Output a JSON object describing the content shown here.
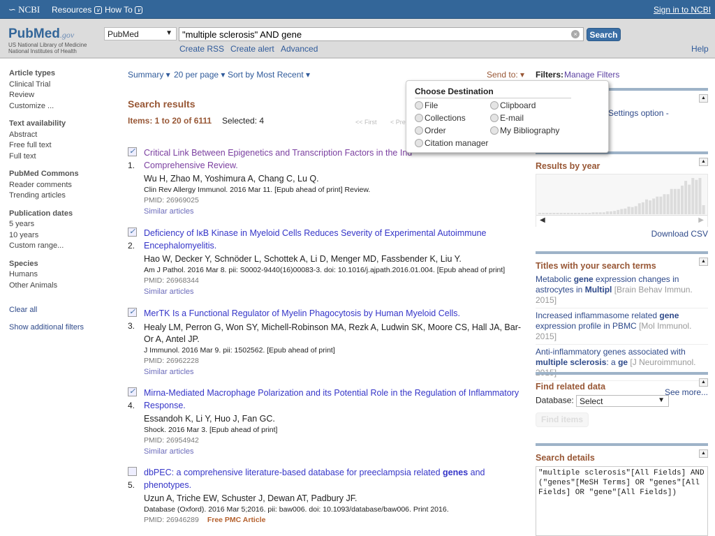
{
  "topbar": {
    "ncbi": "NCBI",
    "resources": "Resources",
    "howto": "How To",
    "signin": "Sign in to NCBI"
  },
  "header": {
    "logo": "PubMed",
    "logo_suffix": ".gov",
    "org1": "US National Library of Medicine",
    "org2": "National Institutes of Health",
    "database": "PubMed",
    "query": "\"multiple sclerosis\" AND gene",
    "search": "Search",
    "links": [
      "Create RSS",
      "Create alert",
      "Advanced"
    ],
    "help": "Help"
  },
  "sidebar": {
    "groups": [
      {
        "title": "Article types",
        "items": [
          "Clinical Trial",
          "Review",
          "Customize ..."
        ]
      },
      {
        "title": "Text availability",
        "items": [
          "Abstract",
          "Free full text",
          "Full text"
        ]
      },
      {
        "title": "PubMed Commons",
        "items": [
          "Reader comments",
          "Trending articles"
        ]
      },
      {
        "title": "Publication dates",
        "items": [
          "5 years",
          "10 years",
          "Custom range..."
        ]
      },
      {
        "title": "Species",
        "items": [
          "Humans",
          "Other Animals"
        ]
      }
    ],
    "clear_all": "Clear all",
    "show_filters": "Show additional filters"
  },
  "toolbar": {
    "summary": "Summary",
    "per_page": "20 per page",
    "sort": "Sort by Most Recent",
    "send_to": "Send to:",
    "filters": "Filters:",
    "manage": "Manage Filters"
  },
  "results": {
    "heading": "Search results",
    "items_label": "Items: 1 to 20 of 6111",
    "selected": "Selected: 4",
    "first": "<< First",
    "prev": "< Prev",
    "list": [
      {
        "n": "1.",
        "checked": true,
        "visited": true,
        "title": [
          [
            "Critical Link Between Epigenetics and Transcription Factors in the Ind",
            0
          ]
        ],
        "title2": [
          [
            "Comprehensive Review.",
            0
          ]
        ],
        "authors": "Wu H, Zhao M, Yoshimura A, Chang C, Lu Q.",
        "source": "Clin Rev Allergy Immunol. 2016 Mar 11. [Epub ahead of print] Review.",
        "pmid": "PMID: 26969025",
        "similar": "Similar articles"
      },
      {
        "n": "2.",
        "checked": true,
        "visited": false,
        "title": [
          [
            "Deficiency of IκB Kinase in Myeloid Cells Reduces Severity of Experimental Autoimmune",
            0
          ]
        ],
        "title2": [
          [
            "Encephalomyelitis.",
            0
          ]
        ],
        "authors": "Hao W, Decker Y, Schnöder L, Schottek A, Li D, Menger MD, Fassbender K, Liu Y.",
        "source": "Am J Pathol. 2016 Mar 8. pii: S0002-9440(16)00083-3. doi: 10.1016/j.ajpath.2016.01.004. [Epub ahead of print]",
        "pmid": "PMID: 26968344",
        "similar": "Similar articles"
      },
      {
        "n": "3.",
        "checked": true,
        "visited": false,
        "title": [
          [
            "MerTK Is a Functional Regulator of Myelin Phagocytosis by Human Myeloid Cells.",
            0
          ]
        ],
        "title2": [],
        "authors": "Healy LM, Perron G, Won SY, Michell-Robinson MA, Rezk A, Ludwin SK, Moore CS, Hall JA, Bar-Or A, Antel JP.",
        "source": "J Immunol. 2016 Mar 9. pii: 1502562. [Epub ahead of print]",
        "pmid": "PMID: 26962228",
        "similar": "Similar articles"
      },
      {
        "n": "4.",
        "checked": true,
        "visited": false,
        "title": [
          [
            "Mirna-Mediated Macrophage Polarization and its Potential Role in the Regulation of Inflammatory",
            0
          ]
        ],
        "title2": [
          [
            "Response.",
            0
          ]
        ],
        "authors": "Essandoh K, Li Y, Huo J, Fan GC.",
        "source": "Shock. 2016 Mar 3. [Epub ahead of print]",
        "pmid": "PMID: 26954942",
        "similar": "Similar articles"
      },
      {
        "n": "5.",
        "checked": false,
        "visited": false,
        "title": [
          [
            "dbPEC: a comprehensive literature-based database for preeclampsia related ",
            0
          ],
          [
            "genes",
            1
          ],
          [
            " and",
            0
          ]
        ],
        "title2": [
          [
            "phenotypes.",
            0
          ]
        ],
        "authors": "Uzun A, Triche EW, Schuster J, Dewan AT, Padbury JF.",
        "source": "Database (Oxford). 2016 Mar 5;2016. pii: baw006. doi: 10.1093/database/baw006. Print 2016.",
        "pmid": "PMID: 26946289",
        "free": "Free PMC Article"
      }
    ]
  },
  "send_menu": {
    "title": "Choose Destination",
    "options": [
      "File",
      "Collections",
      "Order",
      "Citation manager",
      "Clipboard",
      "E-mail",
      "My Bibliography"
    ]
  },
  "right": {
    "settings_text": "Settings option -",
    "results_by_year": {
      "title": "Results by year",
      "download": "Download CSV",
      "bars": [
        3,
        3,
        3,
        3,
        3,
        3,
        3,
        3,
        3,
        3,
        3,
        3,
        3,
        3,
        3,
        4,
        4,
        4,
        4,
        6,
        6,
        7,
        9,
        11,
        12,
        16,
        15,
        17,
        23,
        25,
        31,
        29,
        33,
        37,
        37,
        42,
        42,
        53,
        53,
        53,
        60,
        70,
        62,
        76,
        72,
        76,
        19
      ],
      "bar_color": "#dcdcdc"
    },
    "titles": {
      "title": "Titles with your search terms",
      "items": [
        {
          "text": [
            [
              "Metabolic ",
              0
            ],
            [
              "gene",
              1
            ],
            [
              " expression changes in astrocytes in ",
              0
            ],
            [
              "Multipl",
              1
            ]
          ],
          "journal": "[Brain Behav Immun. 2015]"
        },
        {
          "text": [
            [
              "Increased inflammasome related ",
              0
            ],
            [
              "gene",
              1
            ],
            [
              " expression profile in PBMC ",
              0
            ]
          ],
          "journal": "[Mol Immunol. 2015]"
        },
        {
          "text": [
            [
              "Anti-inflammatory genes associated with ",
              0
            ],
            [
              "multiple sclerosis",
              1
            ],
            [
              ": a ",
              0
            ],
            [
              "ge",
              1
            ]
          ],
          "journal": "[J Neuroimmunol. 2015]"
        }
      ],
      "see_more": "See more..."
    },
    "related": {
      "title": "Find related data",
      "db_label": "Database:",
      "db_value": "Select",
      "find": "Find items"
    },
    "details": {
      "title": "Search details",
      "text": "\"multiple sclerosis\"[All Fields] AND (\"genes\"[MeSH Terms] OR \"genes\"[All Fields] OR \"gene\"[All Fields])"
    }
  },
  "colors": {
    "topbar": "#336699",
    "heading": "#985735",
    "link": "#3535c8",
    "visited": "#7b3fa0"
  }
}
